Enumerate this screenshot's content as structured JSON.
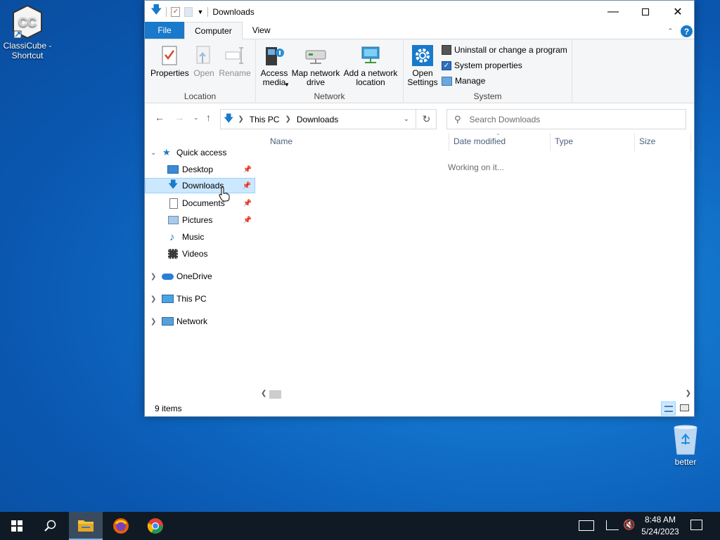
{
  "desktop": {
    "icons": [
      {
        "label": "ClassiCube - Shortcut"
      },
      {
        "label": "better"
      }
    ]
  },
  "window": {
    "title": "Downloads",
    "tabs": {
      "file": "File",
      "computer": "Computer",
      "view": "View"
    },
    "ribbon": {
      "location": {
        "label": "Location",
        "properties": "Properties",
        "open": "Open",
        "rename": "Rename"
      },
      "network": {
        "label": "Network",
        "access_media": "Access media",
        "map_drive": "Map network drive",
        "add_location": "Add a network location"
      },
      "system": {
        "label": "System",
        "open_settings": "Open Settings",
        "uninstall": "Uninstall or change a program",
        "properties": "System properties",
        "manage": "Manage"
      }
    },
    "address": {
      "root": "This PC",
      "current": "Downloads"
    },
    "search": {
      "placeholder": "Search Downloads"
    },
    "nav": {
      "quick_access": "Quick access",
      "items": [
        "Desktop",
        "Downloads",
        "Documents",
        "Pictures",
        "Music",
        "Videos"
      ],
      "onedrive": "OneDrive",
      "thispc": "This PC",
      "network": "Network"
    },
    "columns": {
      "name": "Name",
      "date": "Date modified",
      "type": "Type",
      "size": "Size"
    },
    "loading": "Working on it...",
    "status": "9 items"
  },
  "taskbar": {
    "time": "8:48 AM",
    "date": "5/24/2023"
  },
  "colors": {
    "accent": "#1979ca",
    "taskbar": "#101a24",
    "selection": "#cce8ff"
  }
}
